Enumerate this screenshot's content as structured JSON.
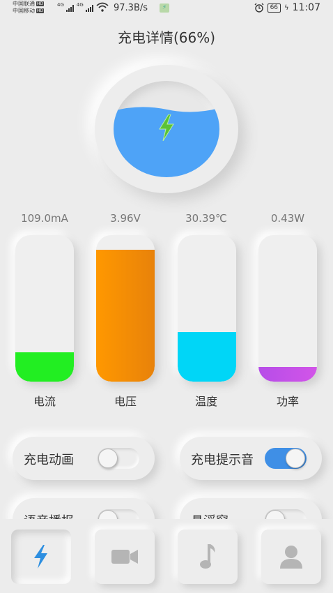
{
  "status_bar": {
    "carrier1": "中国联通",
    "carrier2": "中国移动",
    "hd": "HD",
    "net1": "4G",
    "net2": "4G",
    "net_speed": "97.3B/s",
    "battery_level": "66",
    "time": "11:07"
  },
  "title": "充电详情(66%)",
  "charge_percent": 66,
  "colors": {
    "water": "#4ea3f7",
    "bolt": "#5bc236",
    "current": "#22ee22",
    "voltage": "#f08a00",
    "temperature": "#00d6f7",
    "power": "#c24ce6",
    "toggle_on": "#3f8fe6",
    "tab_active": "#2e8fe0"
  },
  "gauges": [
    {
      "value": "109.0mA",
      "label": "电流",
      "fill_percent": 20
    },
    {
      "value": "3.96V",
      "label": "电压",
      "fill_percent": 90
    },
    {
      "value": "30.39℃",
      "label": "温度",
      "fill_percent": 34
    },
    {
      "value": "0.43W",
      "label": "功率",
      "fill_percent": 10
    }
  ],
  "settings": [
    {
      "label": "充电动画",
      "on": false
    },
    {
      "label": "充电提示音",
      "on": true
    },
    {
      "label": "语音播报",
      "on": false
    },
    {
      "label": "悬浮窗",
      "on": false
    }
  ],
  "tabs": [
    {
      "icon": "lightning-icon",
      "active": true
    },
    {
      "icon": "video-camera-icon",
      "active": false
    },
    {
      "icon": "music-note-icon",
      "active": false
    },
    {
      "icon": "person-icon",
      "active": false
    }
  ]
}
